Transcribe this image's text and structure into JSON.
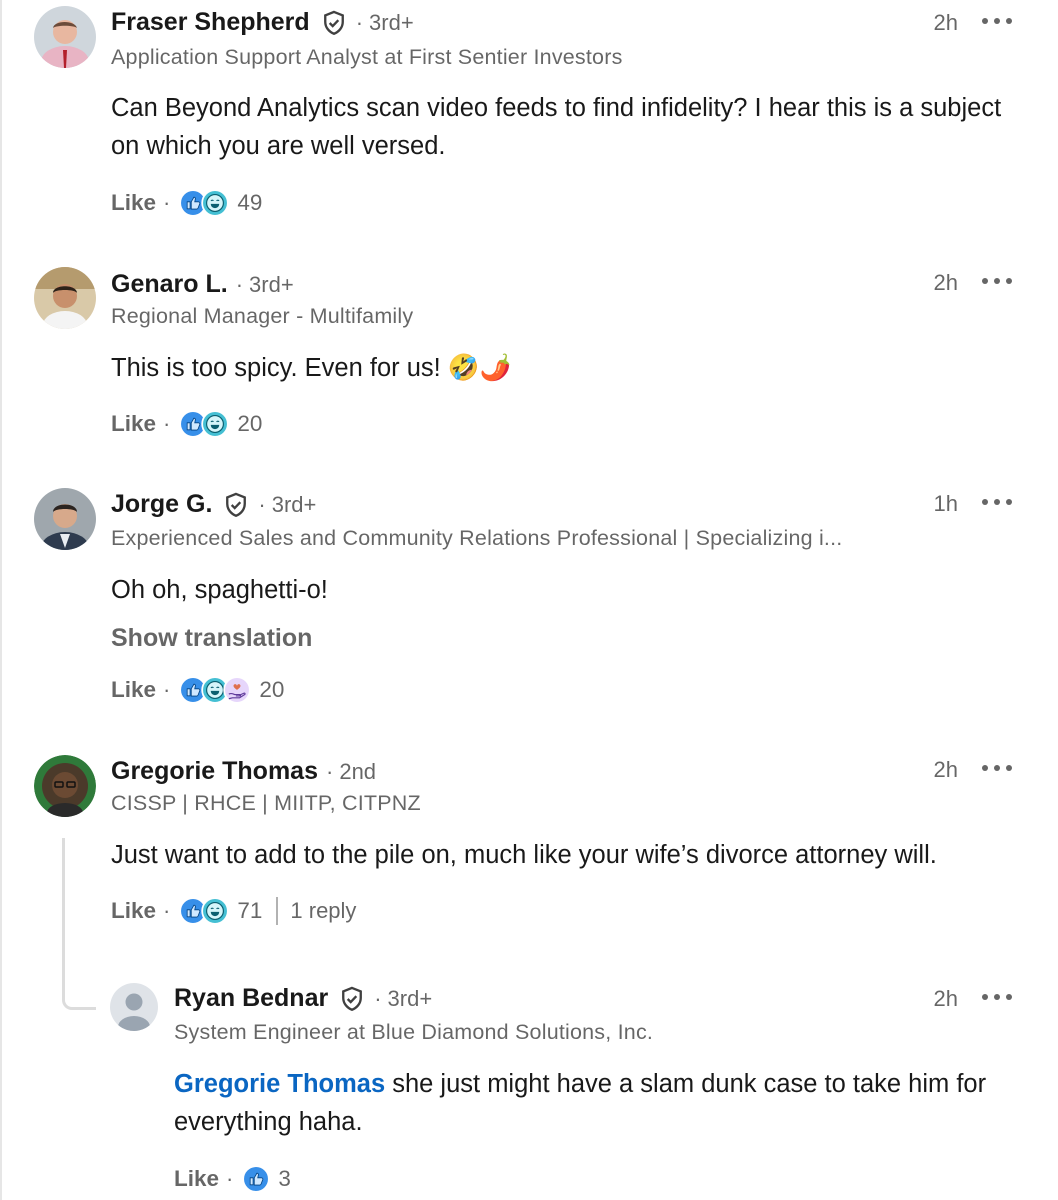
{
  "comments": [
    {
      "name": "Fraser Shepherd",
      "degree": "3rd+",
      "headline": "Application Support Analyst at First Sentier Investors",
      "time": "2h",
      "text": "Can Beyond Analytics scan video feeds to find infidelity? I hear this is a subject on which you are well versed.",
      "like_label": "Like",
      "reaction_count": "49"
    },
    {
      "name": "Genaro L.",
      "degree": "3rd+",
      "headline": "Regional Manager - Multifamily",
      "time": "2h",
      "text": "This is too spicy. Even for us! 🤣🌶️",
      "like_label": "Like",
      "reaction_count": "20"
    },
    {
      "name": "Jorge G.",
      "degree": "3rd+",
      "headline": "Experienced Sales and Community Relations Professional | Specializing i...",
      "time": "1h",
      "text": "Oh oh, spaghetti-o!",
      "translate_label": "Show translation",
      "like_label": "Like",
      "reaction_count": "20"
    },
    {
      "name": "Gregorie Thomas",
      "degree": "2nd",
      "headline": "CISSP | RHCE | MIITP, CITPNZ",
      "time": "2h",
      "text": "Just want to add to the pile on, much like your wife’s divorce attorney will.",
      "like_label": "Like",
      "reaction_count": "71",
      "reply_count_label": "1 reply"
    }
  ],
  "reply": {
    "name": "Ryan Bednar",
    "degree": "3rd+",
    "headline": "System Engineer at Blue Diamond Solutions, Inc.",
    "time": "2h",
    "mention": "Gregorie Thomas",
    "text": " she just might have a slam dunk case to take him for everything haha.",
    "like_label": "Like",
    "reaction_count": "3"
  },
  "separator": "·",
  "icons": {
    "verified": "verified-shield-icon",
    "more": "more-options-icon",
    "like": "like-reaction-icon",
    "funny": "funny-reaction-icon",
    "support": "support-reaction-icon"
  },
  "colors": {
    "link": "#0a66c2",
    "like_blue": "#378fe9",
    "funny_teal": "#44bfd3",
    "support_purple": "#a872e8"
  }
}
